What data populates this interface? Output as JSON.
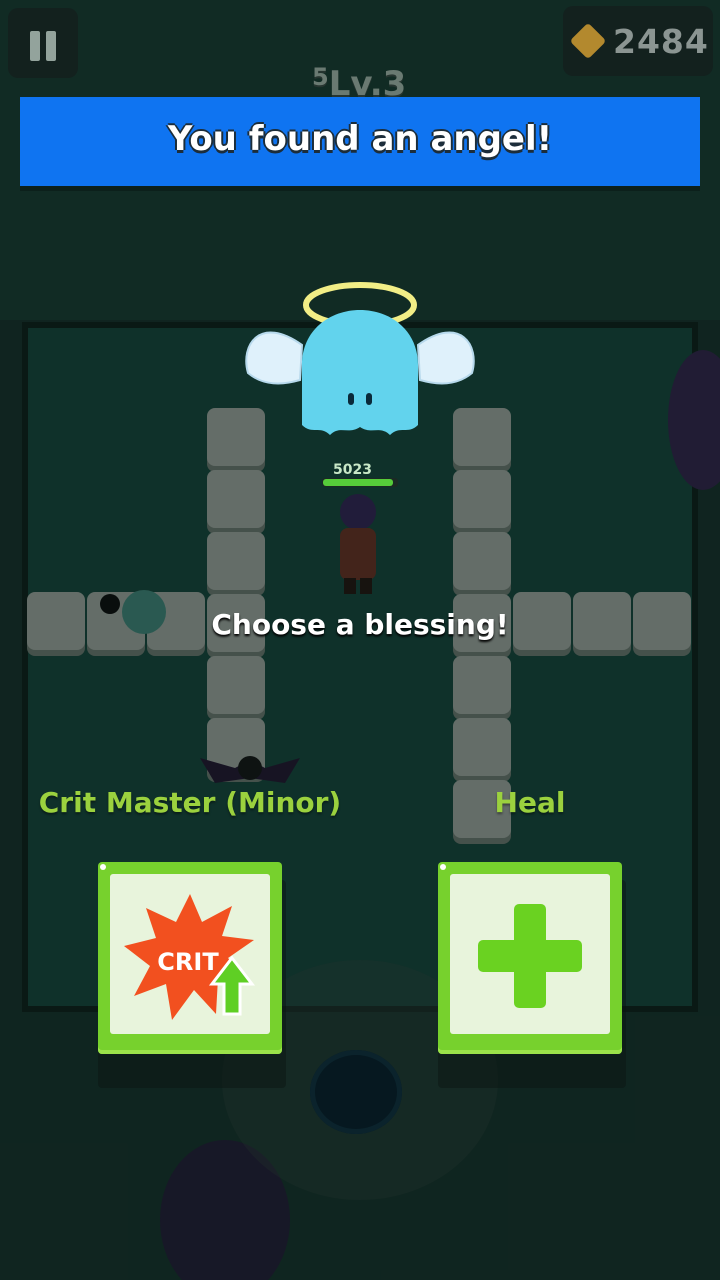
{
  "hud": {
    "gem_count": "2484",
    "level_text": "Lv.3",
    "level_super": "5"
  },
  "banner": {
    "title": "You found an angel!"
  },
  "npc": {
    "hp_value": "5023",
    "hp_fraction": 0.95
  },
  "prompt": "Choose a blessing!",
  "options": [
    {
      "name": "Crit Master (Minor)",
      "icon": "crit-up-icon",
      "icon_text": "CRIT"
    },
    {
      "name": "Heal",
      "icon": "heal-plus-icon"
    }
  ],
  "colors": {
    "banner": "#0f74f1",
    "option_text": "#9bd13e",
    "card_frame": "#77d12d",
    "crit_burst": "#f2501f",
    "heal_cross": "#6ad221"
  }
}
